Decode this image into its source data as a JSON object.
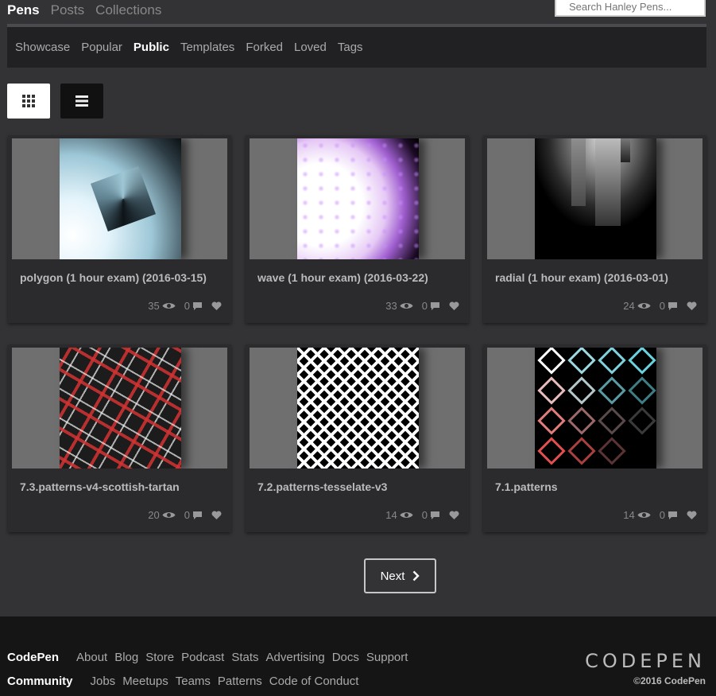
{
  "top_tabs": [
    {
      "label": "Pens",
      "active": true
    },
    {
      "label": "Posts",
      "active": false
    },
    {
      "label": "Collections",
      "active": false
    }
  ],
  "search": {
    "placeholder": "Search Hanley Pens..."
  },
  "subnav": [
    {
      "label": "Showcase",
      "active": false
    },
    {
      "label": "Popular",
      "active": false
    },
    {
      "label": "Public",
      "active": true
    },
    {
      "label": "Templates",
      "active": false
    },
    {
      "label": "Forked",
      "active": false
    },
    {
      "label": "Loved",
      "active": false
    },
    {
      "label": "Tags",
      "active": false
    }
  ],
  "view_toggle": {
    "grid_icon": "grid-icon",
    "list_icon": "list-icon",
    "selected": "grid"
  },
  "pens": [
    {
      "title": "polygon (1 hour exam) (2016-03-15)",
      "views": "35",
      "comments": "0",
      "preview": "polygon"
    },
    {
      "title": "wave (1 hour exam) (2016-03-22)",
      "views": "33",
      "comments": "0",
      "preview": "wave"
    },
    {
      "title": "radial (1 hour exam) (2016-03-01)",
      "views": "24",
      "comments": "0",
      "preview": "radial"
    },
    {
      "title": "7.3.patterns-v4-scottish-tartan",
      "views": "20",
      "comments": "0",
      "preview": "tartan"
    },
    {
      "title": "7.2.patterns-tesselate-v3",
      "views": "14",
      "comments": "0",
      "preview": "tesselate"
    },
    {
      "title": "7.1.patterns",
      "views": "14",
      "comments": "0",
      "preview": "patterns"
    }
  ],
  "pagination": {
    "next_label": "Next"
  },
  "footer": {
    "codepen_heading": "CodePen",
    "codepen_links": [
      "About",
      "Blog",
      "Store",
      "Podcast",
      "Stats",
      "Advertising",
      "Docs",
      "Support"
    ],
    "community_heading": "Community",
    "community_links": [
      "Jobs",
      "Meetups",
      "Teams",
      "Patterns",
      "Code of Conduct"
    ],
    "logo_text": "CODEPEN",
    "copyright": "©2016 CodePen"
  },
  "colors": {
    "background": "#333336",
    "card": "#2b2b2e",
    "footer": "#151515"
  }
}
